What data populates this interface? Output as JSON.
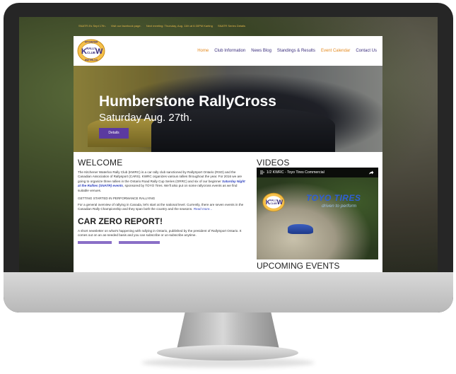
{
  "announcement": [
    "SNATR 8's Sept 17th.",
    "Visit our facebook page.",
    "Next meeting: Thursday, Aug. 11th at 6:30PM Karting",
    "SNATR Series Details"
  ],
  "logo": {
    "top_text": "KITCHENER",
    "left_letter": "K",
    "middle_line1": "RALLY",
    "middle_line2": "CLUB",
    "right_letter": "W",
    "bottom_text": "WATERLOO"
  },
  "nav": {
    "home": "Home",
    "club_information": "Club Information",
    "news_blog": "News Blog",
    "standings": "Standings & Results",
    "event_calendar": "Event Calendar",
    "contact": "Contact Us"
  },
  "hero": {
    "title": "Humberstone RallyCross",
    "subtitle": "Saturday Aug. 27th.",
    "button": "Details"
  },
  "welcome": {
    "heading": "WELCOME",
    "p1_a": "The Kitchener Waterloo Rally Club (KWRC) is a car rally club sanctioned by RallySport Ontario (RSO) and the Canadian Association of Rallysport (CARS). KWRC organizes various rallies throughout the year. For 2016 we are going to organize three rallies in the Ontario Road Rally Cup Series (ORRC) and six of our beginner",
    "p1_link": "Saturday Night at the Rallies (SNATR) events",
    "p1_b": ", sponsored by TOYO Tires. We'll also put on some rallycross events as we find suitable venues.",
    "getting_started": "GETTING STARTED IN PERFORMANCE RALLYING",
    "p2_a": "For a general overview of rallying in Canada, let's start at the national level. Currently, there are seven events in the Canadian Rally Championship and they span both the country and the seasons.",
    "p2_link": "Read more..."
  },
  "car_zero": {
    "heading": "CAR ZERO REPORT!",
    "text": "A short newsletter on what's happening with rallying in Ontario, published by the president of RallySport Ontario. It comes out on an as-needed basis and you can subscribe or un-subscribe anytime."
  },
  "videos": {
    "heading": "VIDEOS",
    "video_counter": "1/2",
    "video_title": "KWRC - Toyo Tires Commercial",
    "toyo_brand": "TOYO TIRES",
    "toyo_tagline": "driven to perform"
  },
  "upcoming": {
    "heading": "UPCOMING EVENTS"
  },
  "colors": {
    "accent_orange": "#e48a1e",
    "nav_purple": "#3a2d7c",
    "button_purple": "#5b3aa0",
    "link_blue": "#2a3dbd",
    "announce_gold": "#e4b64a"
  }
}
